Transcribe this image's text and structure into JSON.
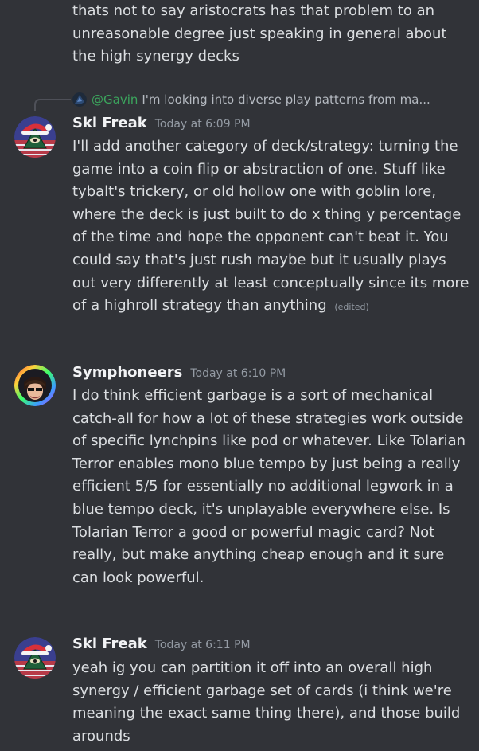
{
  "messages": {
    "continued": {
      "text": "thats not to say aristocrats has that problem to an unreasonable degree just speaking in general about the high synergy decks"
    },
    "first": {
      "reply": {
        "name": "@Gavin",
        "preview": "I'm looking into diverse play patterns from ma..."
      },
      "username": "Ski Freak",
      "timestamp": "Today at 6:09 PM",
      "text": "I'll add another category of deck/strategy: turning the game into a coin flip or abstraction of one. Stuff like tybalt's trickery, or old hollow one with goblin lore, where the deck is just built to do x thing y percentage of the time and hope the opponent can't beat it. You could say that's just rush maybe but it usually plays out very differently at least conceptually since its more of a highroll strategy than anything",
      "edited": "(edited)"
    },
    "second": {
      "username": "Symphoneers",
      "timestamp": "Today at 6:10 PM",
      "text": "I do think efficient garbage is a sort of mechanical catch-all for how a lot of these strategies work outside of specific lynchpins like pod or whatever. Like Tolarian Terror enables mono blue tempo by just being a really efficient 5/5 for essentially no additional legwork in a blue tempo deck, it's unplayable everywhere else. Is Tolarian Terror a good or powerful magic card? Not really, but make anything cheap enough and it sure can look powerful."
    },
    "third": {
      "username": "Ski Freak",
      "timestamp": "Today at 6:11 PM",
      "text": "yeah ig you can partition it off into an overall high synergy / efficient garbage set of cards (i think we're meaning the exact same thing there), and those build arounds"
    }
  },
  "colors": {
    "background": "#313338",
    "username": "#f2f3f5",
    "text": "#dbdee1",
    "muted": "#949ba4",
    "reply_name": "#3ba55d"
  },
  "icons": {
    "ski_freak_avatar": "illuminati-eye-santa-hat-avatar",
    "symphoneers_avatar": "rainbow-ring-character-avatar",
    "gavin_avatar": "small-dark-blue-avatar"
  }
}
